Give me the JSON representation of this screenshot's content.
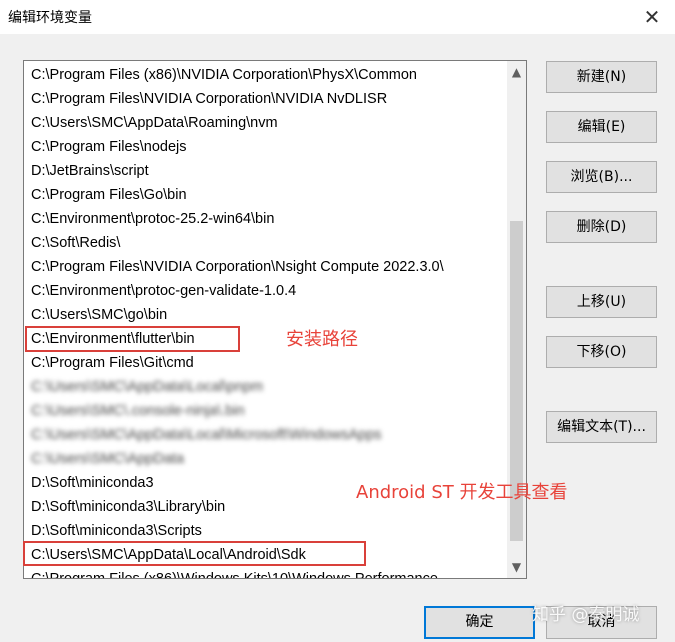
{
  "window": {
    "title": "编辑环境变量",
    "close_icon": "✕"
  },
  "list": {
    "items": [
      {
        "text": "C:\\Program Files (x86)\\NVIDIA Corporation\\PhysX\\Common",
        "blurred": false
      },
      {
        "text": "C:\\Program Files\\NVIDIA Corporation\\NVIDIA NvDLISR",
        "blurred": false
      },
      {
        "text": "C:\\Users\\SMC\\AppData\\Roaming\\nvm",
        "blurred": false
      },
      {
        "text": "C:\\Program Files\\nodejs",
        "blurred": false
      },
      {
        "text": "D:\\JetBrains\\script",
        "blurred": false
      },
      {
        "text": "C:\\Program Files\\Go\\bin",
        "blurred": false
      },
      {
        "text": "C:\\Environment\\protoc-25.2-win64\\bin",
        "blurred": false
      },
      {
        "text": "C:\\Soft\\Redis\\",
        "blurred": false
      },
      {
        "text": "C:\\Program Files\\NVIDIA Corporation\\Nsight Compute 2022.3.0\\",
        "blurred": false
      },
      {
        "text": "C:\\Environment\\protoc-gen-validate-1.0.4",
        "blurred": false
      },
      {
        "text": "C:\\Users\\SMC\\go\\bin",
        "blurred": false
      },
      {
        "text": "C:\\Environment\\flutter\\bin",
        "blurred": false
      },
      {
        "text": "C:\\Program Files\\Git\\cmd",
        "blurred": false
      },
      {
        "text": "C:\\Users\\SMC\\AppData\\Local\\pnpm",
        "blurred": true
      },
      {
        "text": "C:\\Users\\SMC\\.console-ninja\\.bin",
        "blurred": true
      },
      {
        "text": "C:\\Users\\SMC\\AppData\\Local\\Microsoft\\WindowsApps",
        "blurred": true
      },
      {
        "text": "C:\\Users\\SMC\\AppData",
        "blurred": true
      },
      {
        "text": "D:\\Soft\\miniconda3",
        "blurred": false
      },
      {
        "text": "D:\\Soft\\miniconda3\\Library\\bin",
        "blurred": false
      },
      {
        "text": "D:\\Soft\\miniconda3\\Scripts",
        "blurred": false
      },
      {
        "text": "C:\\Users\\SMC\\AppData\\Local\\Android\\Sdk",
        "blurred": false
      },
      {
        "text": "C:\\Program Files (x86)\\Windows Kits\\10\\Windows Performance",
        "blurred": false
      }
    ],
    "scroll_up_icon": "▲",
    "scroll_down_icon": "▼"
  },
  "annotations": {
    "install_path": "安装路径",
    "android_st": "Android ST 开发工具查看",
    "color": "#e8433a"
  },
  "buttons": {
    "new": "新建(N)",
    "edit": "编辑(E)",
    "browse": "浏览(B)...",
    "delete": "删除(D)",
    "move_up": "上移(U)",
    "move_down": "下移(O)",
    "edit_text": "编辑文本(T)...",
    "ok": "确定",
    "cancel": "取消"
  },
  "watermark": "知乎 @秦明诚"
}
